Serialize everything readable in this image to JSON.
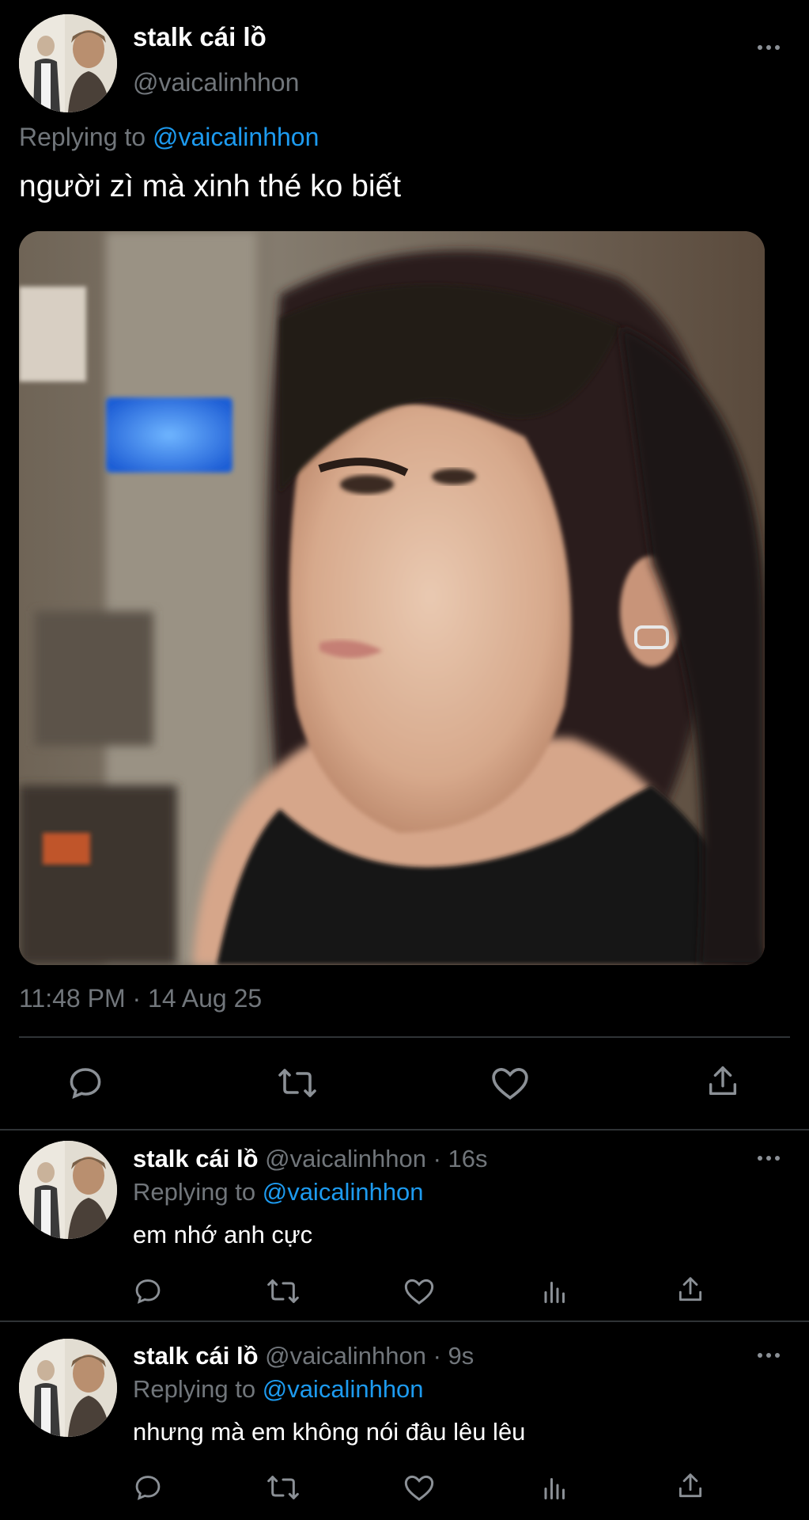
{
  "main_tweet": {
    "display_name": "stalk cái lồ",
    "handle": "@vaicalinhhon",
    "replying_prefix": "Replying to",
    "replying_mention": "@vaicalinhhon",
    "text": "người zì mà xinh thé ko biết",
    "timestamp": "11:48 PM · 14 Aug 25",
    "actions": [
      "reply-icon",
      "retweet-icon",
      "like-icon",
      "share-icon"
    ]
  },
  "replies": [
    {
      "display_name": "stalk cái lồ",
      "handle": "@vaicalinhhon",
      "time": "· 16s",
      "replying_prefix": "Replying to",
      "replying_mention": "@vaicalinhhon",
      "text": "em nhớ anh cực",
      "actions": [
        "reply-icon",
        "retweet-icon",
        "like-icon",
        "analytics-icon",
        "share-icon"
      ]
    },
    {
      "display_name": "stalk cái lồ",
      "handle": "@vaicalinhhon",
      "time": "· 9s",
      "replying_prefix": "Replying to",
      "replying_mention": "@vaicalinhhon",
      "text": "nhưng mà em không nói đâu lêu lêu",
      "actions": [
        "reply-icon",
        "retweet-icon",
        "like-icon",
        "analytics-icon",
        "share-icon"
      ]
    }
  ],
  "colors": {
    "background": "#000000",
    "text": "#ffffff",
    "muted": "#71767b",
    "link": "#1d9bf0",
    "divider": "#2f3336"
  }
}
